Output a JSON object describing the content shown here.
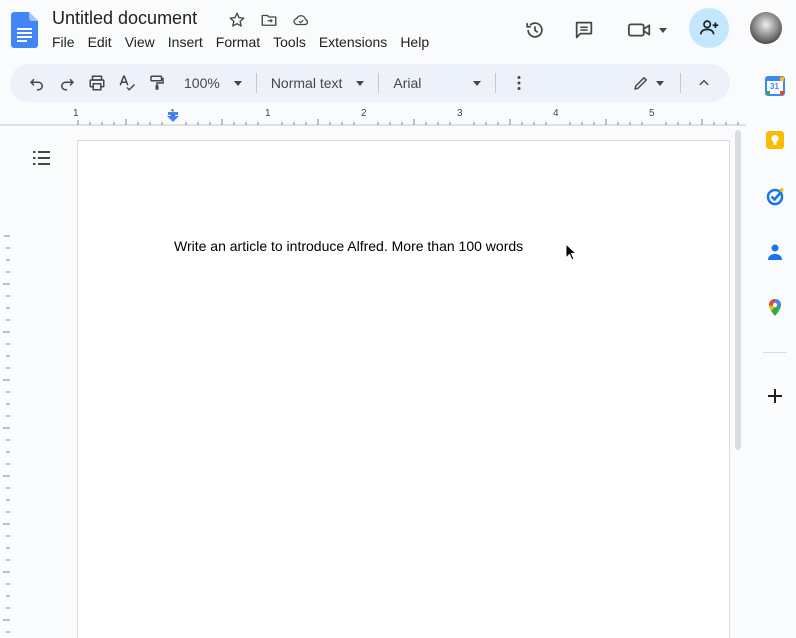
{
  "document": {
    "title": "Untitled document",
    "body_text": "Write an article to introduce Alfred. More than 100 words"
  },
  "menubar": {
    "items": [
      "File",
      "Edit",
      "View",
      "Insert",
      "Format",
      "Tools",
      "Extensions",
      "Help"
    ]
  },
  "toolbar": {
    "zoom": "100%",
    "paragraph_style": "Normal text",
    "font": "Arial"
  },
  "ruler": {
    "labels": [
      "1",
      "1",
      "1",
      "2",
      "3",
      "4",
      "5"
    ]
  },
  "icons": {
    "title": [
      "star-icon",
      "move-to-folder-icon",
      "cloud-saved-icon"
    ],
    "top_right": [
      "version-history-icon",
      "comments-icon",
      "meet-icon"
    ],
    "toolbar": [
      "undo-icon",
      "redo-icon",
      "print-icon",
      "spellcheck-icon",
      "paint-format-icon",
      "more-icon",
      "editing-mode-icon",
      "collapse-icon"
    ],
    "side_panel": [
      "calendar-icon",
      "keep-icon",
      "tasks-icon",
      "contacts-icon",
      "maps-icon",
      "add-icon"
    ]
  },
  "colors": {
    "accent_blue": "#4285f4",
    "share_bg": "#c2e7ff",
    "toolbar_bg": "#edf2fa",
    "keep_yellow": "#fbbc04"
  },
  "side_panel": {
    "calendar_day": "31"
  }
}
